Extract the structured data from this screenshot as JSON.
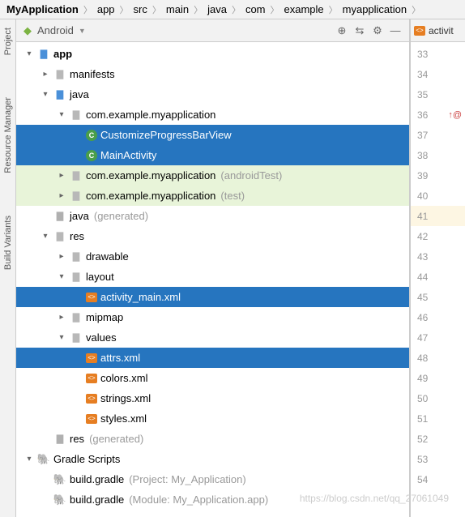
{
  "breadcrumb": [
    {
      "label": "MyApplication",
      "bold": true
    },
    {
      "label": "app"
    },
    {
      "label": "src"
    },
    {
      "label": "main"
    },
    {
      "label": "java"
    },
    {
      "label": "com"
    },
    {
      "label": "example"
    },
    {
      "label": "myapplication"
    }
  ],
  "left_tabs": [
    "Project",
    "Resource Manager",
    "Build Variants"
  ],
  "panel": {
    "view_label": "Android",
    "toolbar_icons": [
      "target-icon",
      "collapse-icon",
      "gear-icon",
      "minimize-icon"
    ]
  },
  "tree": [
    {
      "depth": 0,
      "arrow": "down",
      "icon": "folder-blue",
      "label": "app",
      "bold": true
    },
    {
      "depth": 1,
      "arrow": "right",
      "icon": "folder",
      "label": "manifests"
    },
    {
      "depth": 1,
      "arrow": "down",
      "icon": "folder-blue",
      "label": "java"
    },
    {
      "depth": 2,
      "arrow": "down",
      "icon": "folder",
      "label": "com.example.myapplication"
    },
    {
      "depth": 3,
      "arrow": "",
      "icon": "class",
      "label": "CustomizeProgressBarView",
      "sel": true
    },
    {
      "depth": 3,
      "arrow": "",
      "icon": "class",
      "label": "MainActivity",
      "sel": true
    },
    {
      "depth": 2,
      "arrow": "right",
      "icon": "folder",
      "label": "com.example.myapplication",
      "suffix": "(androidTest)",
      "green": true
    },
    {
      "depth": 2,
      "arrow": "right",
      "icon": "folder",
      "label": "com.example.myapplication",
      "suffix": "(test)",
      "green": true
    },
    {
      "depth": 1,
      "arrow": "",
      "icon": "folder-grey",
      "label": "java",
      "suffix": "(generated)"
    },
    {
      "depth": 1,
      "arrow": "down",
      "icon": "folder",
      "label": "res"
    },
    {
      "depth": 2,
      "arrow": "right",
      "icon": "folder",
      "label": "drawable"
    },
    {
      "depth": 2,
      "arrow": "down",
      "icon": "folder",
      "label": "layout"
    },
    {
      "depth": 3,
      "arrow": "",
      "icon": "xml",
      "label": "activity_main.xml",
      "sel": true
    },
    {
      "depth": 2,
      "arrow": "right",
      "icon": "folder",
      "label": "mipmap"
    },
    {
      "depth": 2,
      "arrow": "down",
      "icon": "folder",
      "label": "values"
    },
    {
      "depth": 3,
      "arrow": "",
      "icon": "xml",
      "label": "attrs.xml",
      "sel": true
    },
    {
      "depth": 3,
      "arrow": "",
      "icon": "xml",
      "label": "colors.xml"
    },
    {
      "depth": 3,
      "arrow": "",
      "icon": "xml",
      "label": "strings.xml"
    },
    {
      "depth": 3,
      "arrow": "",
      "icon": "xml",
      "label": "styles.xml"
    },
    {
      "depth": 1,
      "arrow": "",
      "icon": "folder-grey",
      "label": "res",
      "suffix": "(generated)"
    },
    {
      "depth": 0,
      "arrow": "down",
      "icon": "gradle",
      "label": "Gradle Scripts"
    },
    {
      "depth": 1,
      "arrow": "",
      "icon": "gradle",
      "label": "build.gradle",
      "suffix": "(Project: My_Application)"
    },
    {
      "depth": 1,
      "arrow": "",
      "icon": "gradle",
      "label": "build.gradle",
      "suffix": "(Module: My_Application.app)"
    }
  ],
  "editor_tab": {
    "filename": "activit"
  },
  "gutter": {
    "start": 33,
    "end": 54,
    "markers": {
      "36": "↑@"
    },
    "highlight": 41
  },
  "watermark": "https://blog.csdn.net/qq_27061049"
}
